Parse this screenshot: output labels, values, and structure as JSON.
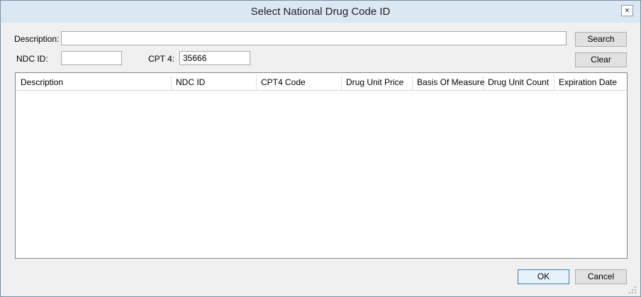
{
  "window": {
    "title": "Select National Drug Code ID",
    "close_label": "×"
  },
  "form": {
    "description_label": "Description:",
    "description_value": "",
    "ndc_label": "NDC ID:",
    "ndc_value": "",
    "cpt4_label": "CPT 4:",
    "cpt4_value": "35666"
  },
  "buttons": {
    "search": "Search",
    "clear": "Clear",
    "ok": "OK",
    "cancel": "Cancel"
  },
  "grid": {
    "columns": [
      "Description",
      "NDC ID",
      "CPT4 Code",
      "Drug Unit Price",
      "Basis Of Measure",
      "Drug Unit Count",
      "Expiration Date"
    ],
    "rows": []
  }
}
